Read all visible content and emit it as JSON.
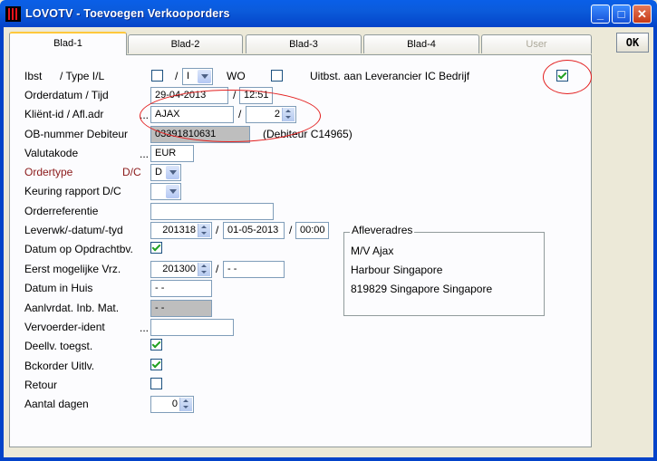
{
  "window": {
    "title": "LOVOTV - Toevoegen Verkooporders",
    "minimize": "_",
    "maximize": "□",
    "close": "✕"
  },
  "ok_label": "OK",
  "tabs": [
    {
      "label": "Blad-1"
    },
    {
      "label": "Blad-2"
    },
    {
      "label": "Blad-3"
    },
    {
      "label": "Blad-4"
    },
    {
      "label": "User"
    }
  ],
  "form": {
    "ibst_label": "Ibst",
    "type_label": "/ Type I/L",
    "type_value": "I",
    "wo_label": "WO",
    "uitbst_label": "Uitbst. aan Leverancier IC Bedrijf",
    "orderdatum_label": "Orderdatum / Tijd",
    "orderdatum_value": "29-04-2013",
    "tijd_value": "12:51",
    "klient_label": "Kliënt-id / Afl.adr",
    "klient_value": "AJAX",
    "afladr_value": "2",
    "ob_label": "OB-nummer Debiteur",
    "ob_value": "03391810631",
    "debiteur_text": "(Debiteur C14965)",
    "valutakode_label": "Valutakode",
    "valutakode_value": "EUR",
    "ordertype_label": "Ordertype",
    "dc_label": "D/C",
    "ordertype_value": "D",
    "keuring_label": "Keuring rapport D/C",
    "keuring_value": "",
    "orderreferentie_label": "Orderreferentie",
    "orderreferentie_value": "",
    "leverwk_label": "Leverwk/-datum/-tyd",
    "leverwk_value": "201318",
    "leverdatum_value": "01-05-2013",
    "levertijd_value": "00:00",
    "datum_opdracht_label": "Datum op Opdrachtbv.",
    "eerst_label": "Eerst mogelijke Vrz.",
    "eerst_week_value": "201300",
    "eerst_datum_value": "- -",
    "datum_huis_label": "Datum in Huis",
    "datum_huis_value": "- -",
    "aanlvrdat_label": "Aanlvrdat. Inb. Mat.",
    "aanlvrdat_value": "- -",
    "vervoerder_label": "Vervoerder-ident",
    "vervoerder_value": "",
    "deellv_label": "Deellv. toegst.",
    "bckorder_label": "Bckorder Uitlv.",
    "retour_label": "Retour",
    "aantal_label": "Aantal dagen",
    "aantal_value": "0",
    "slash": "/",
    "dots": "..."
  },
  "afleveradres": {
    "title": "Afleveradres",
    "line1": "M/V Ajax",
    "line2": "Harbour Singapore",
    "line3": "819829  Singapore  Singapore"
  }
}
